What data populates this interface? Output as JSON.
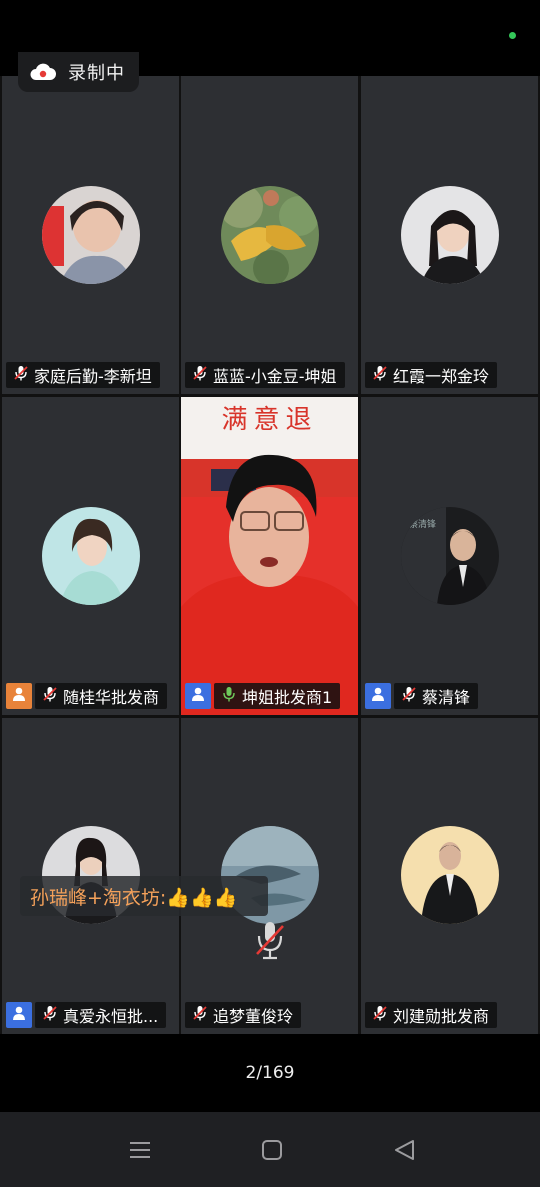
{
  "recording": {
    "label": "录制中"
  },
  "tiles": [
    {
      "name": "家庭后勤-李新坦",
      "muted": true,
      "role": ""
    },
    {
      "name": "蓝蓝-小金豆-坤姐",
      "muted": true,
      "role": ""
    },
    {
      "name": "红霞一郑金玲",
      "muted": true,
      "role": ""
    },
    {
      "name": "随桂华批发商",
      "muted": true,
      "role": "orange"
    },
    {
      "name": "坤姐批发商1",
      "muted": false,
      "role": "blue"
    },
    {
      "name": "蔡清锋",
      "muted": true,
      "role": "blue"
    },
    {
      "name": "真爱永恒批...",
      "muted": true,
      "role": "blue"
    },
    {
      "name": "追梦董俊玲",
      "muted": true,
      "role": ""
    },
    {
      "name": "刘建勋批发商",
      "muted": true,
      "role": ""
    }
  ],
  "video_overlay": {
    "banner_text": "满意退"
  },
  "comment": {
    "text": "孙瑞峰+淘衣坊:👍👍👍"
  },
  "pagination": {
    "text": "2/169"
  },
  "colors": {
    "accent_green": "#6ec85a",
    "host_blue": "#3b6fe0",
    "cohost_orange": "#e8833a",
    "comment_orange": "#f4a15a"
  },
  "icons": [
    "cloud-record-icon",
    "mic-muted-icon",
    "mic-on-icon",
    "person-icon",
    "menu-icon",
    "home-icon",
    "back-icon"
  ]
}
